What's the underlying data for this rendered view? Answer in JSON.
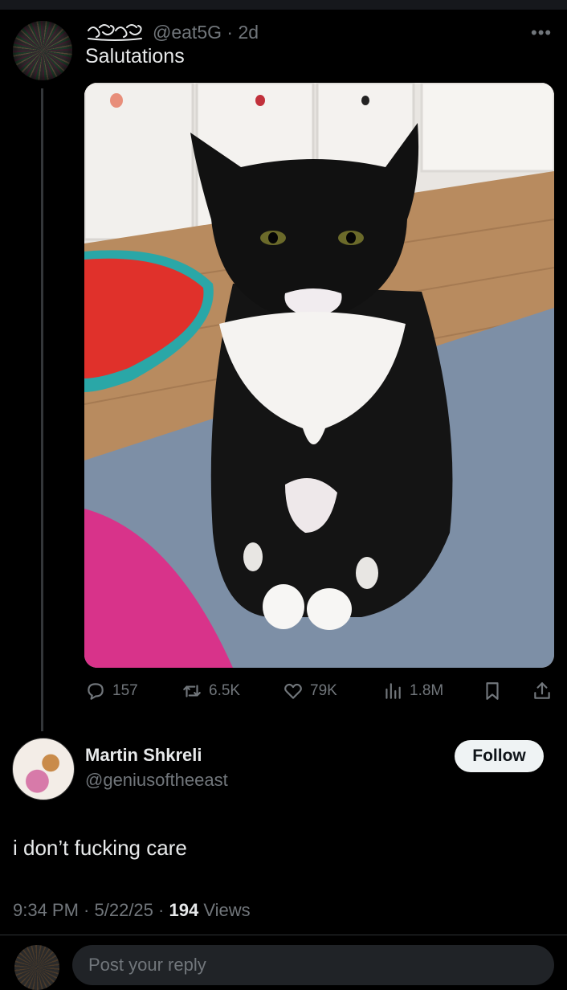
{
  "tweet": {
    "handle": "@eat5G",
    "time": "2d",
    "text": "Salutations",
    "actions": {
      "replies": "157",
      "reposts": "6.5K",
      "likes": "79K",
      "views": "1.8M"
    }
  },
  "reply": {
    "name": "Martin Shkreli",
    "handle": "@geniusoftheeast",
    "follow_label": "Follow",
    "text": "i don’t fucking care",
    "time": "9:34 PM",
    "date": "5/22/25",
    "views_count": "194",
    "views_label": "Views"
  },
  "compose": {
    "placeholder": "Post your reply"
  },
  "colors": {
    "background": "#000000",
    "muted": "#71767b",
    "text": "#e7e9ea",
    "follow_bg": "#eff3f4"
  }
}
